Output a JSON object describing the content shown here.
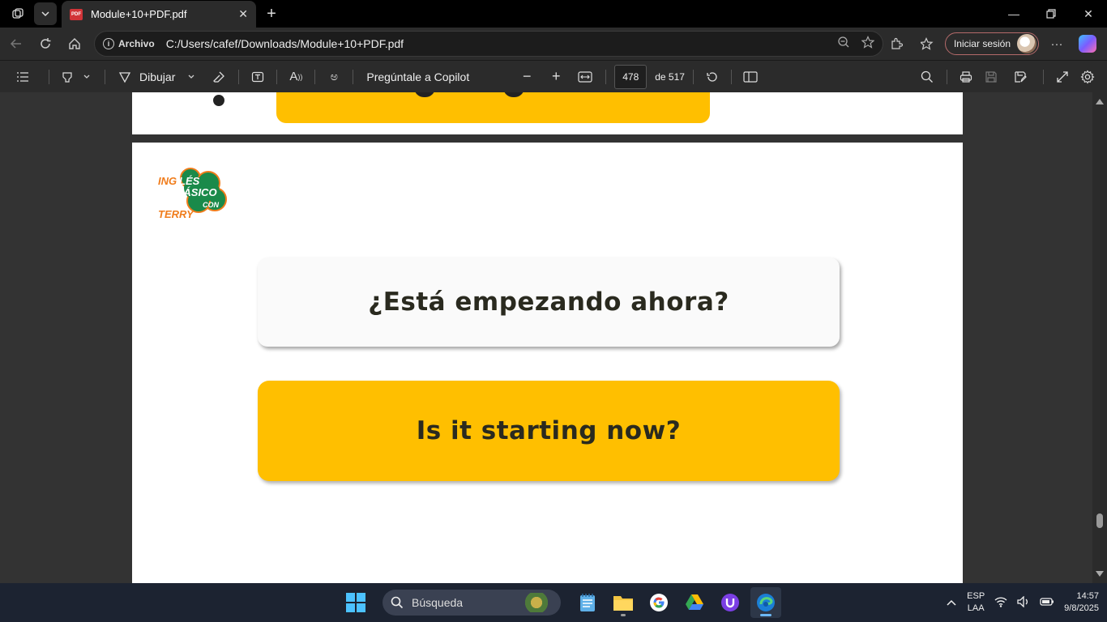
{
  "browser": {
    "tab_title": "Module+10+PDF.pdf",
    "tab_badge": "PDF",
    "address_label": "Archivo",
    "url": "C:/Users/cafef/Downloads/Module+10+PDF.pdf",
    "signin_label": "Iniciar sesión"
  },
  "pdf_toolbar": {
    "draw_label": "Dibujar",
    "copilot_label": "Pregúntale a Copilot",
    "read_aloud_glyph": "A",
    "translate_glyph": "ಅ",
    "current_page": "478",
    "page_total": "de 517"
  },
  "document": {
    "logo_lines": [
      "INGLÉS",
      "BÁSICO",
      "CON",
      "TERRY"
    ],
    "question": "¿Está empezando ahora?",
    "answer": "Is it starting now?",
    "colors": {
      "answer_card": "#ffbf00",
      "logo_green": "#1a8a4a",
      "logo_orange": "#f07c1b"
    }
  },
  "taskbar": {
    "search_placeholder": "Búsqueda",
    "lang_top": "ESP",
    "lang_bottom": "LAA",
    "time": "14:57",
    "date": "9/8/2025"
  }
}
